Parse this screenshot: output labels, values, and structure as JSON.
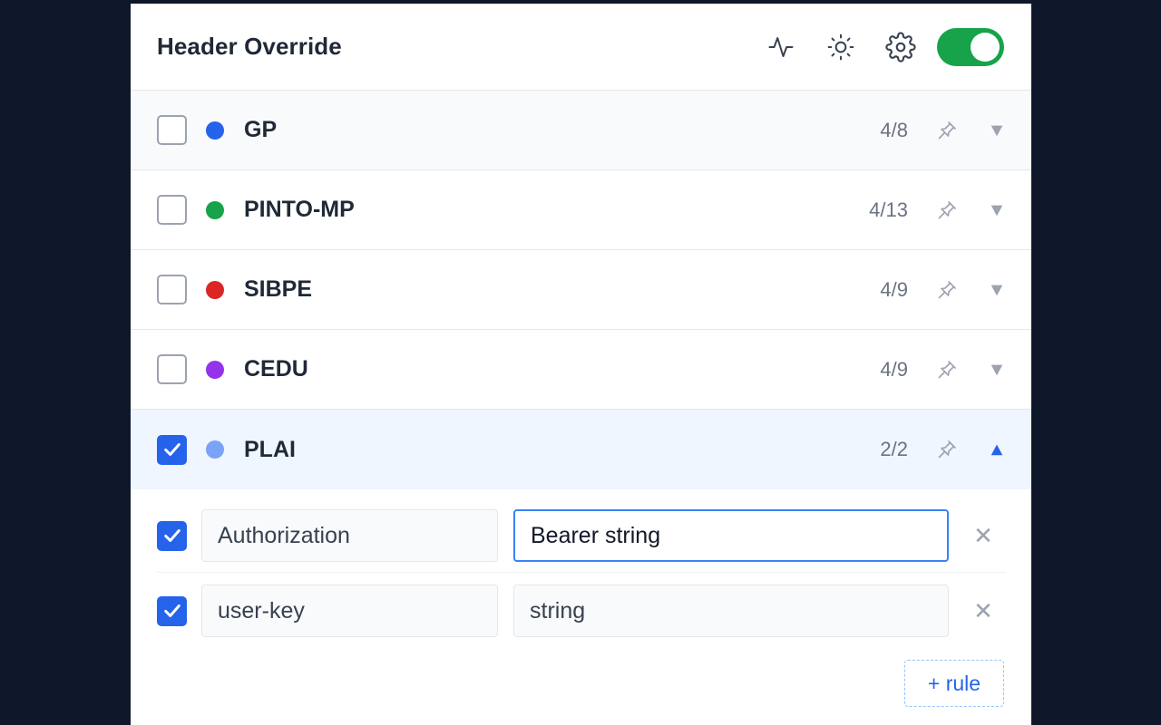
{
  "header": {
    "title": "Header Override",
    "icons": [
      "activity-icon",
      "sun-icon",
      "gear-icon"
    ],
    "enabled": true,
    "toggle_color": "#16a34a"
  },
  "groups": [
    {
      "name": "GP",
      "count": "4/8",
      "color": "#2563eb",
      "checked": false,
      "expanded": false
    },
    {
      "name": "PINTO-MP",
      "count": "4/13",
      "color": "#16a34a",
      "checked": false,
      "expanded": false
    },
    {
      "name": "SIBPE",
      "count": "4/9",
      "color": "#dc2626",
      "checked": false,
      "expanded": false
    },
    {
      "name": "CEDU",
      "count": "4/9",
      "color": "#9333ea",
      "checked": false,
      "expanded": false
    },
    {
      "name": "PLAI",
      "count": "2/2",
      "color": "#7aa2f7",
      "checked": true,
      "expanded": true
    }
  ],
  "rules": [
    {
      "enabled": true,
      "key": "Authorization",
      "value": "Bearer string"
    },
    {
      "enabled": true,
      "key": "user-key",
      "value": "string"
    }
  ],
  "add_rule_label": "+ rule",
  "colors": {
    "accent": "#2563eb",
    "inactive_chevron": "#9ca3af"
  }
}
